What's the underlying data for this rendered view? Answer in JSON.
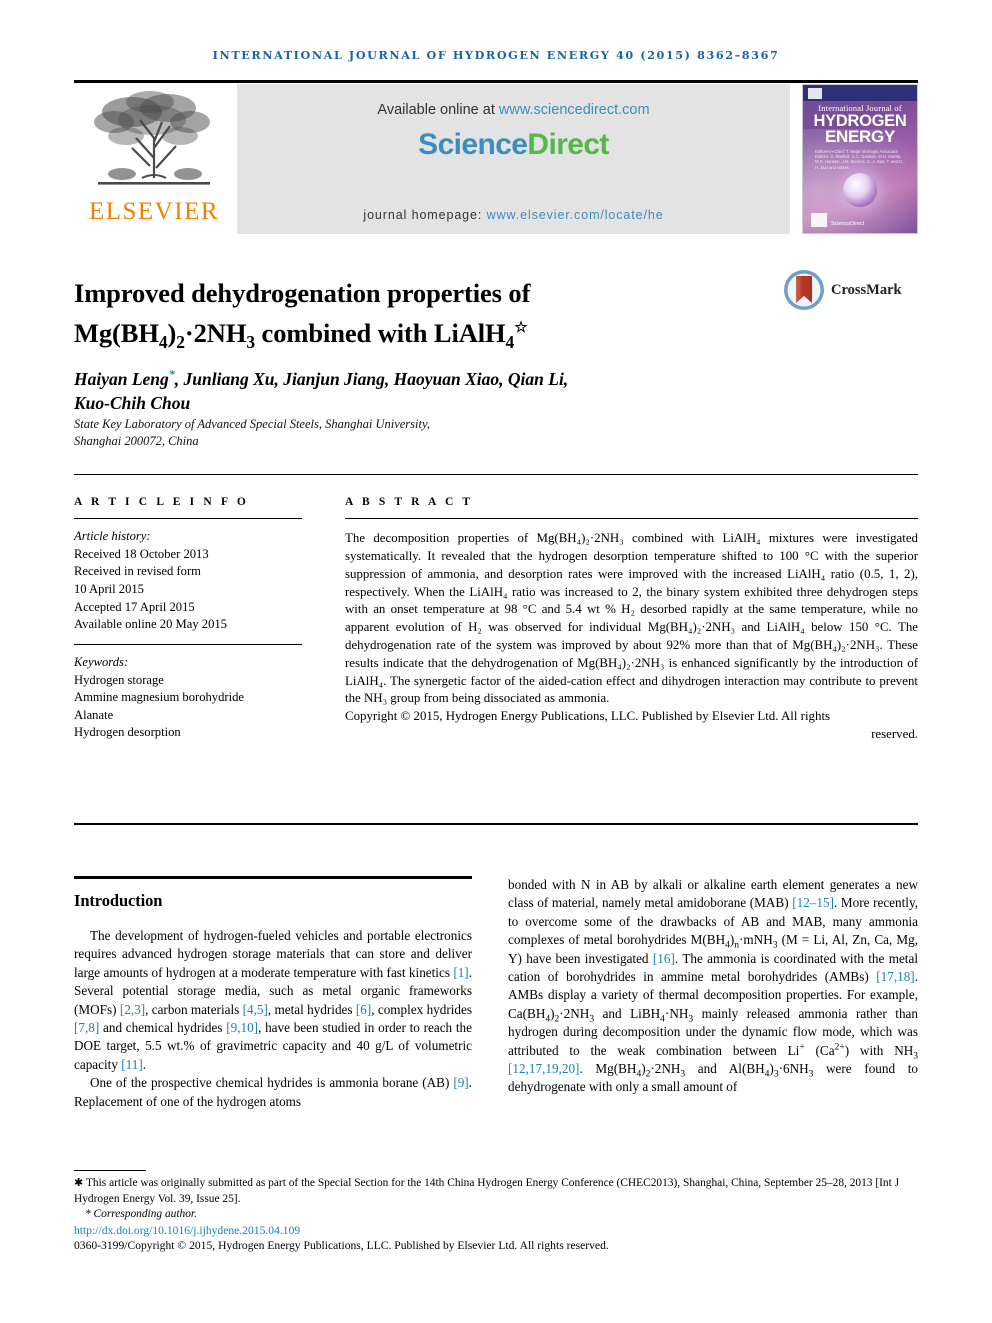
{
  "running_head": "INTERNATIONAL JOURNAL OF HYDROGEN ENERGY 40 (2015) 8362–8367",
  "masthead": {
    "publisher_name": "ELSEVIER",
    "available_prefix": "Available online at ",
    "available_link": "www.sciencedirect.com",
    "sciencedirect_part1": "Science",
    "sciencedirect_part2": "Direct",
    "homepage_prefix": "journal homepage: ",
    "homepage_link": "www.elsevier.com/locate/he",
    "cover": {
      "line1": "International Journal of",
      "line2": "HYDROGEN",
      "line3": "ENERGY",
      "editors": "Editors-in-Chief: T. Nejat Veziroglu\nAssociate Editors: S. Rashidi, C.C. Nandan, M.H. Morita, M.D. Hansen, J.M. Bockris, C.-J. Sun, T. and C.-H. Sun and others",
      "sciencedirect_label": "ScienceDirect"
    }
  },
  "article": {
    "title_line1": "Improved dehydrogenation properties of",
    "title_main": "Mg(BH",
    "title_sub1": "4",
    "title_mid": ")",
    "title_sub2": "2",
    "title_dot": "·2NH",
    "title_sub3": "3",
    "title_tail": " combined with LiAlH",
    "title_sub4": "4",
    "title_star": "☆",
    "crossmark_label": "CrossMark",
    "authors": "Haiyan Leng",
    "authors_rest": ", Junliang Xu, Jianjun Jiang, Haoyuan Xiao, Qian Li,",
    "authors_line2": "Kuo-Chih Chou",
    "author_star": "*",
    "affiliation_line1": "State Key Laboratory of Advanced Special Steels, Shanghai University,",
    "affiliation_line2": "Shanghai 200072, China"
  },
  "article_info": {
    "heading": "A R T I C L E   I N F O",
    "history_label": "Article history:",
    "history": [
      "Received 18 October 2013",
      "Received in revised form",
      "10 April 2015",
      "Accepted 17 April 2015",
      "Available online 20 May 2015"
    ],
    "keywords_label": "Keywords:",
    "keywords": [
      "Hydrogen storage",
      "Ammine magnesium borohydride",
      "Alanate",
      "Hydrogen desorption"
    ]
  },
  "abstract": {
    "heading": "A B S T R A C T",
    "body": "The decomposition properties of Mg(BH₄)₂·2NH₃ combined with LiAlH₄ mixtures were investigated systematically. It revealed that the hydrogen desorption temperature shifted to 100 °C with the superior suppression of ammonia, and desorption rates were improved with the increased LiAlH₄ ratio (0.5, 1, 2), respectively. When the LiAlH₄ ratio was increased to 2, the binary system exhibited three dehydrogen steps with an onset temperature at 98 °C and 5.4 wt % H₂ desorbed rapidly at the same temperature, while no apparent evolution of H₂ was observed for individual Mg(BH₄)₂·2NH₃ and LiAlH₄ below 150 °C. The dehydrogenation rate of the system was improved by about 92% more than that of Mg(BH₄)₂·2NH₃. These results indicate that the dehydrogenation of Mg(BH₄)₂·2NH₃ is enhanced significantly by the introduction of LiAlH₄. The synergetic factor of the aided-cation effect and dihydrogen interaction may contribute to prevent the NH₃ group from being dissociated as ammonia.",
    "copyright_line1": "Copyright © 2015, Hydrogen Energy Publications, LLC. Published by Elsevier Ltd. All rights",
    "copyright_line2": "reserved."
  },
  "introduction": {
    "heading": "Introduction",
    "left_paragraph_1": "The development of hydrogen-fueled vehicles and portable electronics requires advanced hydrogen storage materials that can store and deliver large amounts of hydrogen at a moderate temperature with fast kinetics [1]. Several potential storage media, such as metal organic frameworks (MOFs) [2,3], carbon materials [4,5], metal hydrides [6], complex hydrides [7,8] and chemical hydrides [9,10], have been studied in order to reach the DOE target, 5.5 wt.% of gravimetric capacity and 40 g/L of volumetric capacity [11].",
    "left_paragraph_2": "One of the prospective chemical hydrides is ammonia borane (AB) [9]. Replacement of one of the hydrogen atoms",
    "right_paragraph_1": "bonded with N in AB by alkali or alkaline earth element generates a new class of material, namely metal amidoborane (MAB) [12–15]. More recently, to overcome some of the drawbacks of AB and MAB, many ammonia complexes of metal borohydrides M(BH₄)ₙ·mNH₃ (M = Li, Al, Zn, Ca, Mg, Y) have been investigated [16]. The ammonia is coordinated with the metal cation of borohydrides in ammine metal borohydrides (AMBs) [17,18]. AMBs display a variety of thermal decomposition properties. For example, Ca(BH₄)₂·2NH₃ and LiBH₄·NH₃ mainly released ammonia rather than hydrogen during decomposition under the dynamic flow mode, which was attributed to the weak combination between Li⁺ (Ca²⁺) with NH₃ [12,17,19,20]. Mg(BH₄)₂·2NH₃ and Al(BH₄)₃·6NH₃ were found to dehydrogenate with only a small amount of"
  },
  "footnotes": {
    "star_note": "This article was originally submitted as part of the Special Section for the 14th China Hydrogen Energy Conference (CHEC2013), Shanghai, China, September 25–28, 2013 [Int J Hydrogen Energy Vol. 39, Issue 25].",
    "corresponding": "Corresponding author.",
    "doi": "http://dx.doi.org/10.1016/j.ijhydene.2015.04.109",
    "issn_copyright": "0360-3199/Copyright © 2015, Hydrogen Energy Publications, LLC. Published by Elsevier Ltd. All rights reserved."
  },
  "colors": {
    "link": "#3b8dbd",
    "citation": "#1b7fb5",
    "running_head": "#1b63a5",
    "elsevier_orange": "#f08000",
    "sciencedirect_green": "#53b848",
    "banner_gray": "#e3e3e3"
  }
}
